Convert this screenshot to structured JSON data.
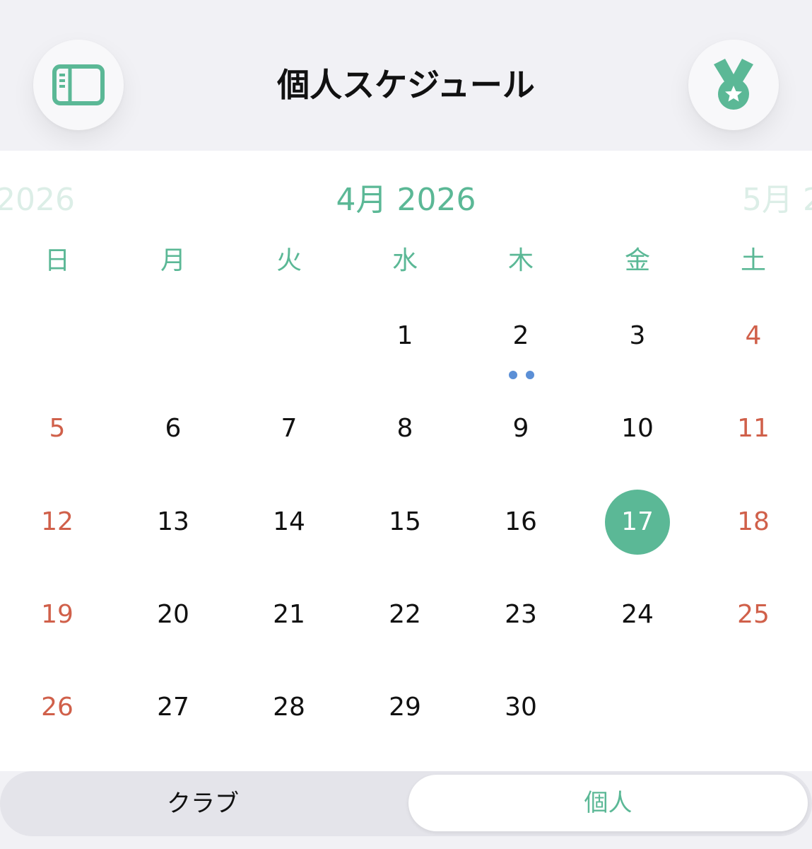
{
  "header": {
    "title": "個人スケジュール",
    "left_icon": "sidebar-icon",
    "right_icon": "medal-icon",
    "accent_color": "#5bb896"
  },
  "calendar": {
    "prev_month_label": "2026",
    "current_month_label": "4月 2026",
    "next_month_label": "5月 2",
    "weekdays": [
      "日",
      "月",
      "火",
      "水",
      "木",
      "金",
      "土"
    ],
    "weeks": [
      [
        "",
        "",
        "",
        "1",
        "2",
        "3",
        "4"
      ],
      [
        "5",
        "6",
        "7",
        "8",
        "9",
        "10",
        "11"
      ],
      [
        "12",
        "13",
        "14",
        "15",
        "16",
        "17",
        "18"
      ],
      [
        "19",
        "20",
        "21",
        "22",
        "23",
        "24",
        "25"
      ],
      [
        "26",
        "27",
        "28",
        "29",
        "30",
        "",
        ""
      ]
    ],
    "selected_day": "17",
    "weekend_color": "#d0604a",
    "event_dot_color": "#5b8fd6"
  },
  "segment": {
    "club_label": "クラブ",
    "personal_label": "個人",
    "active": "個人"
  }
}
